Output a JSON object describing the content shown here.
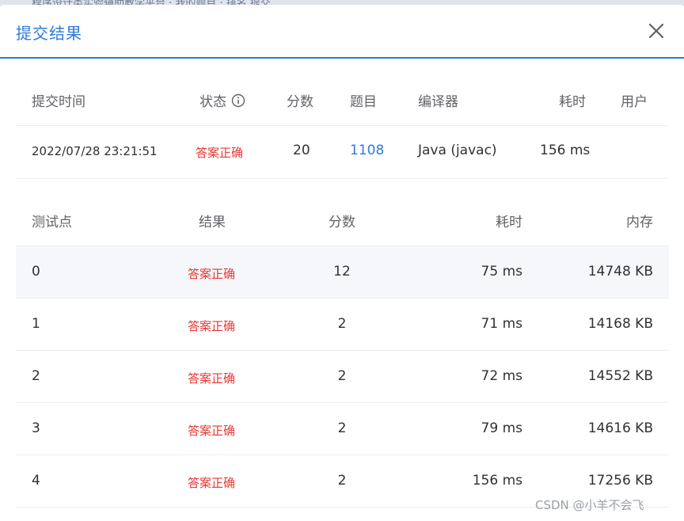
{
  "background_strip": "程序设计类实验辅助教学平台 · 我的题目 · 排名   提交",
  "modal": {
    "title": "提交结果",
    "close_icon": "close-icon"
  },
  "summary": {
    "headers": [
      "提交时间",
      "状态",
      "分数",
      "题目",
      "编译器",
      "耗时",
      "用户"
    ],
    "status_info_icon": "info-circle-icon",
    "row": {
      "time": "2022/07/28 23:21:51",
      "status": "答案正确",
      "score": "20",
      "problem": "1108",
      "compiler": "Java (javac)",
      "duration": "156 ms",
      "user": ""
    }
  },
  "tests": {
    "headers": [
      "测试点",
      "结果",
      "分数",
      "耗时",
      "内存"
    ],
    "rows": [
      {
        "id": "0",
        "result": "答案正确",
        "score": "12",
        "time": "75 ms",
        "memory": "14748 KB"
      },
      {
        "id": "1",
        "result": "答案正确",
        "score": "2",
        "time": "71 ms",
        "memory": "14168 KB"
      },
      {
        "id": "2",
        "result": "答案正确",
        "score": "2",
        "time": "72 ms",
        "memory": "14552 KB"
      },
      {
        "id": "3",
        "result": "答案正确",
        "score": "2",
        "time": "79 ms",
        "memory": "14616 KB"
      },
      {
        "id": "4",
        "result": "答案正确",
        "score": "2",
        "time": "156 ms",
        "memory": "17256 KB"
      }
    ]
  },
  "watermark": "CSDN @小羊不会飞",
  "colors": {
    "accent": "#2f7bd8",
    "success_text": "#e53935",
    "row_shade": "#f5f7fa"
  }
}
